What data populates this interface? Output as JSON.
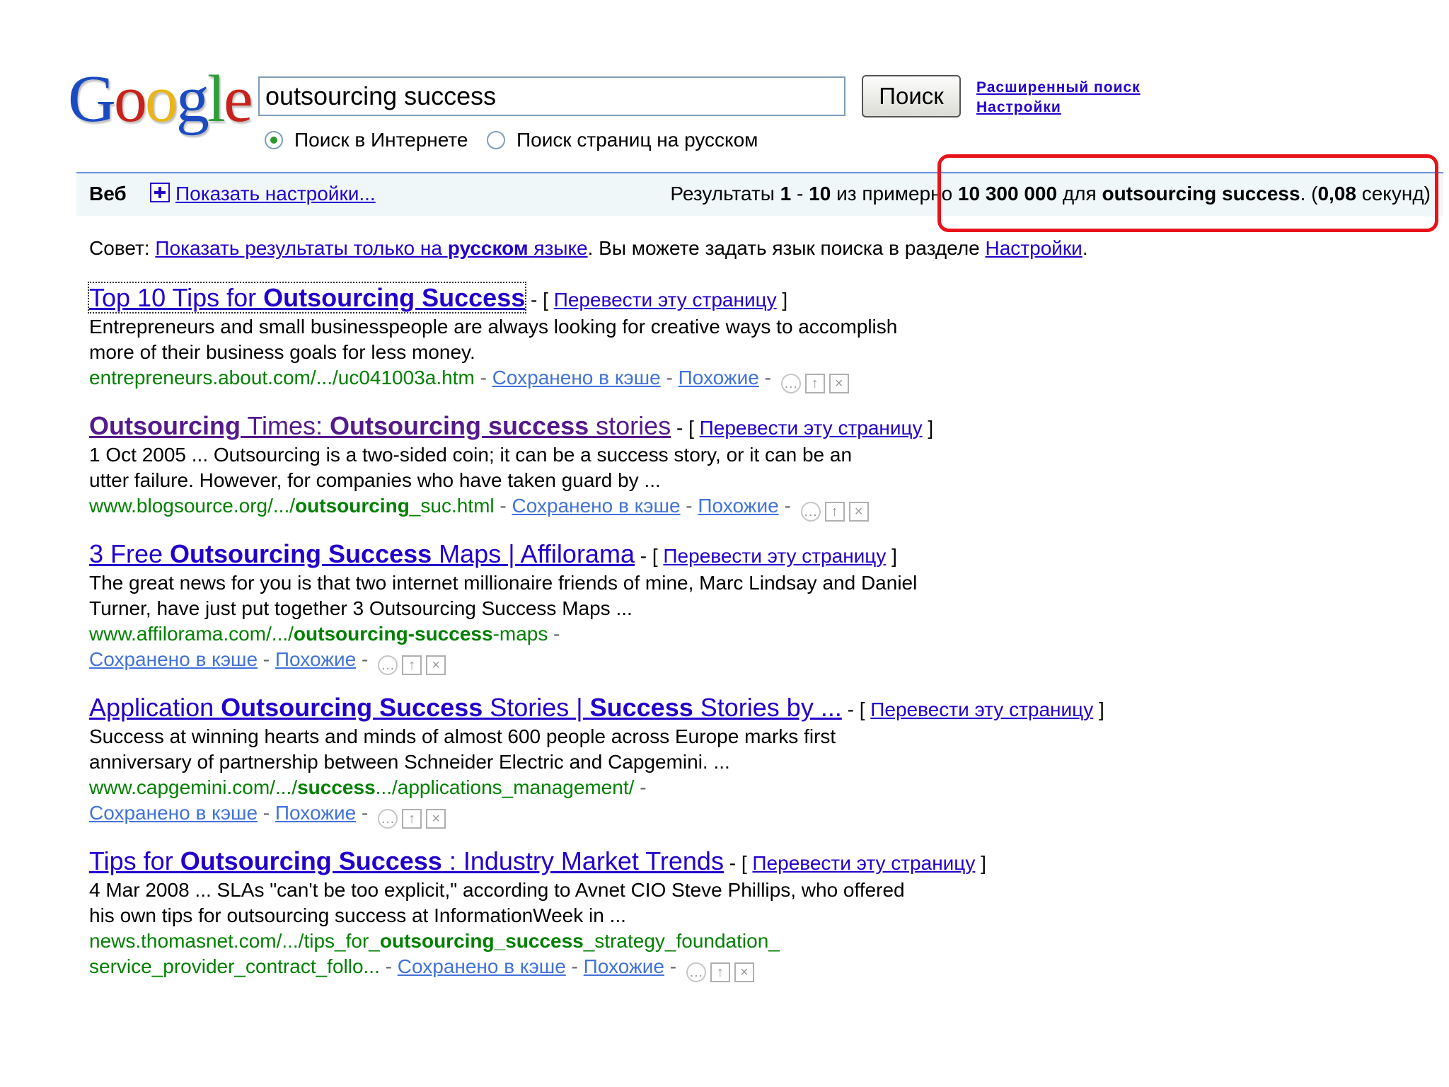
{
  "logo": {
    "text": [
      "G",
      "o",
      "o",
      "g",
      "l",
      "e"
    ],
    "colors": [
      "#1c4bc1",
      "#c8231b",
      "#e8b51a",
      "#1c4bc1",
      "#2f9e3a",
      "#c8231b"
    ]
  },
  "search": {
    "query": "outsourcing success",
    "button": "Поиск",
    "advanced": "Расширенный поиск",
    "settings": "Настройки"
  },
  "radios": {
    "web": "Поиск в Интернете",
    "russian": "Поиск страниц на русском"
  },
  "bar": {
    "web": "Веб",
    "show_options": "Показать настройки...",
    "stats_prefix": "Результаты ",
    "range_start": "1",
    "range_sep": " - ",
    "range_end": "10",
    "of_about": " из примерно ",
    "total": "10 300 000",
    "for": " для ",
    "query": "outsourcing success",
    "time_open": ". (",
    "time": "0,08",
    "time_close": " секунд)"
  },
  "tip": {
    "prefix": "Совет: ",
    "link_a": "Показать результаты только на ",
    "link_b": "русском",
    "link_c": " языке",
    "mid": ". Вы можете задать язык поиска в разделе ",
    "settings": "Настройки",
    "end": "."
  },
  "common": {
    "translate": "Перевести эту страницу",
    "cached": "Сохранено в кэше",
    "similar": "Похожие"
  },
  "results": [
    {
      "t1": "Top 10 Tips for ",
      "t2": "Outsourcing Success",
      "t3": "",
      "t4": "",
      "t5": "",
      "s1": "Entrepreneurs and small businesspeople are always looking for creative ways to accomplish",
      "s2": "more of their business goals for less money.",
      "c1": "entrepreneurs.about.com/.../uc041003a.htm",
      "c2": "",
      "c3": ""
    },
    {
      "t1": "",
      "t2": "Outsourcing",
      "t3": " Times: ",
      "t4": "Outsourcing success",
      "t5": " stories",
      "s1": "1 Oct 2005 ... Outsourcing is a two-sided coin; it can be a success story, or it can be an",
      "s2": "utter failure. However, for companies who have taken guard by ...",
      "c1": "www.blogsource.org/.../",
      "c2": "outsourcing",
      "c3": "_suc.html"
    },
    {
      "t1": "3 Free ",
      "t2": "Outsourcing Success",
      "t3": " Maps | Affilorama",
      "t4": "",
      "t5": "",
      "s1": "The great news for you is that two internet millionaire friends of mine, Marc Lindsay and Daniel",
      "s2": "Turner, have just put together 3 Outsourcing Success Maps ...",
      "c1": "www.affilorama.com/.../",
      "c2": "outsourcing-success",
      "c3": "-maps"
    },
    {
      "t1": "Application ",
      "t2": "Outsourcing Success",
      "t3": " Stories | ",
      "t4": "Success",
      "t5": " Stories by ...",
      "s1": "Success at winning hearts and minds of almost 600 people across Europe marks first",
      "s2": "anniversary of partnership between Schneider Electric and Capgemini. ...",
      "c1": "www.capgemini.com/.../",
      "c2": "success",
      "c3": ".../applications_management/"
    },
    {
      "t1": "Tips for ",
      "t2": "Outsourcing Success",
      "t3": " : Industry Market Trends",
      "t4": "",
      "t5": "",
      "s1": "4 Mar 2008 ... SLAs \"can't be too explicit,\" according to Avnet CIO Steve Phillips, who offered",
      "s2": "his own tips for outsourcing success at InformationWeek in ...",
      "c1": "news.thomasnet.com/.../tips_for_",
      "c2": "outsourcing_success",
      "c3": "_strategy_foundation_",
      "c4": "service_provider_contract_follo..."
    }
  ],
  "colors": {
    "link": "#2200cc",
    "url": "#008000",
    "highlight": "#e8131a",
    "bar": "#f0f7f9"
  }
}
